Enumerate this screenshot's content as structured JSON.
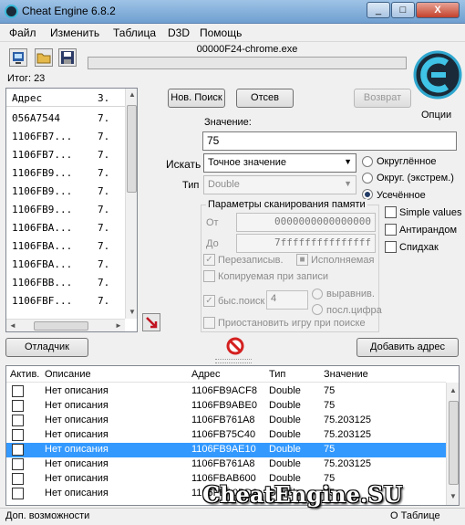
{
  "window": {
    "title": "Cheat Engine 6.8.2",
    "minimize": "_",
    "maximize": "□",
    "close": "X"
  },
  "menu": [
    "Файл",
    "Изменить",
    "Таблица",
    "D3D",
    "Помощь"
  ],
  "toolbar": {
    "process_name": "00000F24-chrome.exe",
    "progress": 0,
    "options_label": "Опции"
  },
  "found": {
    "label": "Итог: 23",
    "columns": [
      "Адрес",
      "З."
    ],
    "rows": [
      {
        "addr": "056A7544",
        "val": "7."
      },
      {
        "addr": "1106FB7...",
        "val": "7."
      },
      {
        "addr": "1106FB7...",
        "val": "7."
      },
      {
        "addr": "1106FB9...",
        "val": "7."
      },
      {
        "addr": "1106FB9...",
        "val": "7."
      },
      {
        "addr": "1106FB9...",
        "val": "7."
      },
      {
        "addr": "1106FBA...",
        "val": "7."
      },
      {
        "addr": "1106FBA...",
        "val": "7."
      },
      {
        "addr": "1106FBA...",
        "val": "7."
      },
      {
        "addr": "1106FBB...",
        "val": "7."
      },
      {
        "addr": "1106FBF...",
        "val": "7."
      }
    ]
  },
  "scan": {
    "new_scan": "Нов. Поиск",
    "next_scan": "Отсев",
    "undo_scan": "Возврат",
    "value_label": "Значение:",
    "value": "75",
    "scan_type_label": "Искать",
    "scan_type": "Точное значение",
    "value_type_label": "Тип",
    "value_type": "Double",
    "rounding": [
      "Округлённое",
      "Округ. (экстрем.)",
      "Усечённое"
    ],
    "rounding_selected": 2,
    "right_checks": [
      "Simple values",
      "Антирандом",
      "Спидхак"
    ],
    "params_title": "Параметры сканирования памяти",
    "from_label": "От",
    "from_value": "0000000000000000",
    "to_label": "До",
    "to_value": "7fffffffffffffff",
    "writable": "Перезаписыв.",
    "executable": "Исполняемая",
    "copy_on_write": "Копируемая при записи",
    "fast_scan": "быс.поиск",
    "fast_scan_value": "4",
    "alignment": "выравнив.",
    "last_digits": "посл.цифра",
    "pause_game": "Приостановить игру при поиске"
  },
  "bottom_buttons": {
    "debugger": "Отладчик",
    "add_address": "Добавить адрес"
  },
  "table": {
    "columns": [
      "Актив.",
      "Описание",
      "Адрес",
      "Тип",
      "Значение"
    ],
    "rows": [
      {
        "desc": "Нет описания",
        "addr": "1106FB9ACF8",
        "type": "Double",
        "value": "75"
      },
      {
        "desc": "Нет описания",
        "addr": "1106FB9ABE0",
        "type": "Double",
        "value": "75"
      },
      {
        "desc": "Нет описания",
        "addr": "1106FB761A8",
        "type": "Double",
        "value": "75.203125"
      },
      {
        "desc": "Нет описания",
        "addr": "1106FB75C40",
        "type": "Double",
        "value": "75.203125"
      },
      {
        "desc": "Нет описания",
        "addr": "1106FB9AE10",
        "type": "Double",
        "value": "75"
      },
      {
        "desc": "Нет описания",
        "addr": "1106FB761A8",
        "type": "Double",
        "value": "75.203125"
      },
      {
        "desc": "Нет описания",
        "addr": "1106FBAB600",
        "type": "Double",
        "value": "75"
      },
      {
        "desc": "Нет описания",
        "addr": "1106FBA0BD0",
        "type": "Double",
        "value": "75"
      }
    ],
    "selected_row": 4
  },
  "status": {
    "left": "Доп. возможности",
    "right": "О Таблице"
  },
  "watermark": "CheatEngine.SU"
}
